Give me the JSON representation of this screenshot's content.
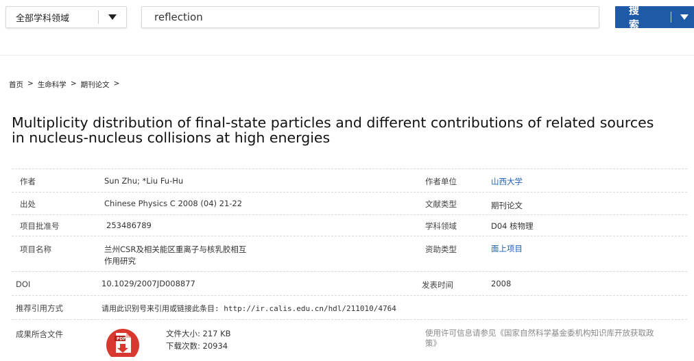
{
  "search": {
    "scope_label": "全部学科领域",
    "query": "reflection",
    "button_label": "搜 索"
  },
  "breadcrumb": [
    {
      "label": "首页"
    },
    {
      "label": "生命科学"
    },
    {
      "label": "期刊论文"
    }
  ],
  "breadcrumb_sep": ">",
  "article": {
    "title": "Multiplicity distribution of final-state particles and different contributions of related sources in nucleus-nucleus collisions at high energies"
  },
  "info": {
    "author_label": "作者",
    "author_value": "Sun Zhu; *Liu Fu-Hu",
    "affiliation_label": "作者单位",
    "affiliation_value": "山西大学",
    "source_label": "出处",
    "source_value": "Chinese Physics C  2008 (04) 21-22",
    "doc_type_label": "文献类型",
    "doc_type_value": "期刊论文",
    "grant_no_label": "项目批准号",
    "grant_no_value": "253486789",
    "field_label": "学科领域",
    "field_value": "D04 核物理",
    "project_label": "项目名称",
    "project_value_line1": "兰州CSR及相关能区重离子与核乳胶相互",
    "project_value_line2": "作用研究",
    "funding_label": "资助类型",
    "funding_value": "面上项目",
    "doi_label": "DOI",
    "doi_value": "10.1029/2007JD008877",
    "pub_time_label": "发表时间",
    "pub_time_value": "2008",
    "cite_label": "推荐引用方式",
    "cite_value": "请用此识别号来引用或链接此条目: http://ir.calis.edu.cn/hdl/211010/4764",
    "files_label": "成果所含文件",
    "file_size": "文件大小: 217 KB",
    "download_count": "下载次数: 20934",
    "license_note": "使用许可信息请参见《国家自然科学基金委机构知识库开放获取政策》",
    "pdf_badge": "PDF"
  },
  "colors": {
    "brand_blue": "#1e5aa5",
    "link_blue": "#1f5fb4",
    "pdf_red": "#d9382e"
  },
  "icons": {
    "scope_dropdown": "chevron-down-icon",
    "search_dropdown": "chevron-down-icon",
    "file": "pdf-file-icon"
  }
}
